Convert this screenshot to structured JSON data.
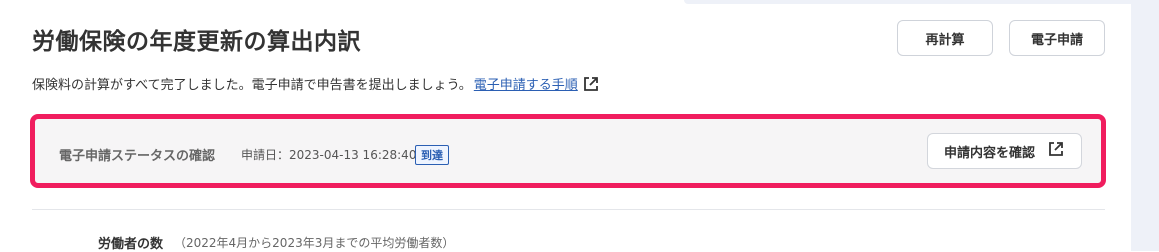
{
  "page": {
    "title": "労働保険の年度更新の算出内訳"
  },
  "header_buttons": {
    "recalc_label": "再計算",
    "efile_label": "電子申請"
  },
  "description": {
    "text": "保険料の計算がすべて完了しました。電子申請で申告書を提出しましょう。",
    "link_label": "電子申請する手順"
  },
  "status": {
    "label": "電子申請ステータスの確認",
    "date_text": "申請日：2023-04-13 16:28:40",
    "badge": "到達",
    "confirm_button_label": "申請内容を確認"
  },
  "workers": {
    "label": "労働者の数",
    "note": "（2022年4月から2023年3月までの平均労働者数）"
  },
  "colors": {
    "highlight_border": "#f01d5e",
    "link": "#2b5fb3",
    "panel_bg": "#f6f5f6"
  },
  "icons": {
    "external_link": "external-link-icon"
  }
}
